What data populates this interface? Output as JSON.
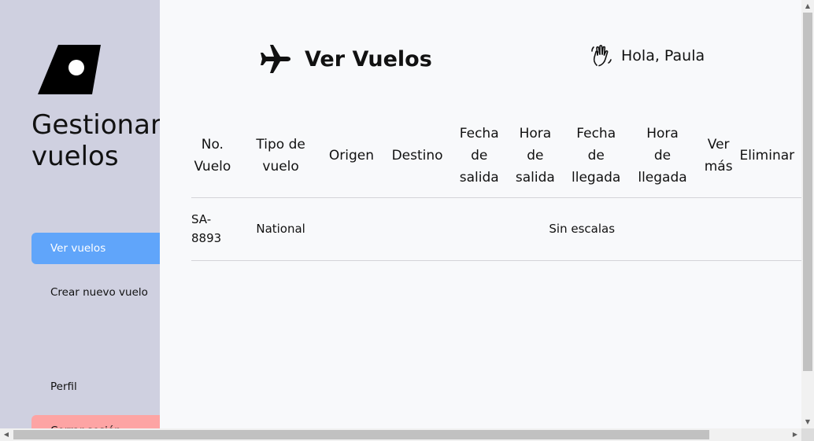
{
  "sidebar": {
    "title_line1": "Gestionar",
    "title_line2": "vuelos",
    "items": [
      {
        "label": "Ver vuelos"
      },
      {
        "label": "Crear nuevo vuelo"
      },
      {
        "label": "Perfil"
      },
      {
        "label": "Cerrar sesión"
      }
    ]
  },
  "header": {
    "title": "Ver Vuelos",
    "greeting": "Hola, Paula"
  },
  "table": {
    "columns": [
      {
        "line1": "No.",
        "line2": "Vuelo"
      },
      {
        "line1": "Tipo de",
        "line2": "vuelo"
      },
      {
        "line1": "Origen"
      },
      {
        "line1": "Destino"
      },
      {
        "line1": "Fecha",
        "line2": "de",
        "line3": "salida"
      },
      {
        "line1": "Hora",
        "line2": "de",
        "line3": "salida"
      },
      {
        "line1": "Fecha",
        "line2": "de",
        "line3": "llegada"
      },
      {
        "line1": "Hora",
        "line2": "de",
        "line3": "llegada"
      },
      {
        "line1": "Ver",
        "line2": "más"
      },
      {
        "line1": "Eliminar"
      }
    ],
    "rows": [
      {
        "no_line1": "SA-",
        "no_line2": "8893",
        "tipo": "National",
        "escalas": "Sin escalas"
      }
    ]
  },
  "icons": {
    "logo": "plane-tail-logo",
    "header": "airplane-icon",
    "greeting": "waving-hand-icon"
  },
  "colors": {
    "sidebar_bg": "#cfd0e0",
    "active_nav": "#60a5fa",
    "logout_nav": "#fda4a4",
    "main_bg": "#f8f9fb"
  }
}
